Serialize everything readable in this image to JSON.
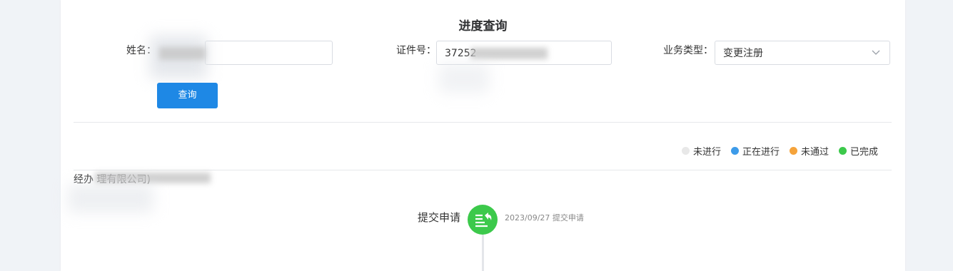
{
  "page": {
    "title": "进度查询"
  },
  "form": {
    "name_label": "姓名：",
    "name_value": "",
    "id_label": "证件号：",
    "id_value": "37252",
    "type_label": "业务类型：",
    "type_value": "变更注册",
    "query_button": "查询"
  },
  "legend": [
    {
      "label": "未进行",
      "color": "#e8e8e8"
    },
    {
      "label": "正在进行",
      "color": "#3d9be9"
    },
    {
      "label": "未通过",
      "color": "#f5a33b"
    },
    {
      "label": "已完成",
      "color": "#3cc94b"
    }
  ],
  "company": {
    "text": "经办                    理有限公司)"
  },
  "timeline": [
    {
      "title": "提交申请",
      "description": "2023/09/27 提交申请",
      "status": "已完成",
      "icon": "submit-list-icon"
    }
  ]
}
